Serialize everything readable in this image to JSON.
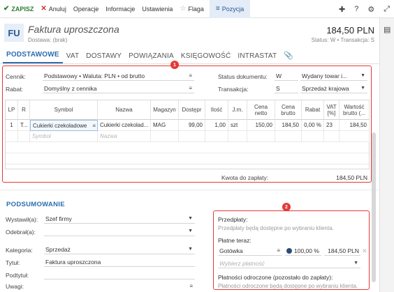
{
  "toolbar": {
    "save": "ZAPISZ",
    "cancel": "Anuluj",
    "operations": "Operacje",
    "info": "Informacje",
    "settings": "Ustawienia",
    "flag": "Flaga",
    "position": "Pozycja"
  },
  "header": {
    "badge": "FU",
    "title": "Faktura uproszczona",
    "subtitle": "Dostawa: (brak)",
    "amount": "184,50 PLN",
    "status_line": "Status: W • Transakcja: S"
  },
  "tabs": [
    "PODSTAWOWE",
    "VAT",
    "DOSTAWY",
    "POWIĄZANIA",
    "KSIĘGOWOŚĆ",
    "INTRASTAT"
  ],
  "markers": {
    "one": "1",
    "two": "2"
  },
  "form": {
    "cennik_label": "Cennik:",
    "cennik_value": "Podstawowy • Waluta: PLN • od brutto",
    "rabat_label": "Rabat:",
    "rabat_value": "Domyślny z cennika",
    "status_label": "Status dokumentu:",
    "status_code": "W",
    "status_value": "Wydany towar i...",
    "trans_label": "Transakcja:",
    "trans_code": "S",
    "trans_value": "Sprzedaż krajowa"
  },
  "grid": {
    "headers": [
      "LP",
      "R",
      "Symbol",
      "Nazwa",
      "Magazyn",
      "Dostępr",
      "Ilość",
      "J.m.",
      "Cena netto",
      "Cena brutto",
      "Rabat",
      "VAT [%]",
      "Wartość brutto (..."
    ],
    "row": {
      "lp": "1",
      "r": "T...",
      "symbol": "Cukierki czekoladowe",
      "nazwa": "Cukierki czekolad...",
      "magazyn": "MAG",
      "dostepne": "99,00",
      "ilosc": "1,00",
      "jm": "szt",
      "cena_netto": "150,00",
      "cena_brutto": "184,50",
      "rabat": "0,00 %",
      "vat": "23",
      "wartosc": "184,50"
    },
    "placeholder_symbol": "Symbol",
    "placeholder_nazwa": "Nazwa",
    "total_label": "Kwota do zapłaty:",
    "total_value": "184,50 PLN"
  },
  "summary": {
    "title": "PODSUMOWANIE",
    "wystawil_label": "Wystawił(a):",
    "wystawil_value": "Szef firmy",
    "odebral_label": "Odebrał(a):",
    "odebral_value": "",
    "kategoria_label": "Kategoria:",
    "kategoria_value": "Sprzedaż",
    "tytul_label": "Tytuł:",
    "tytul_value": "Faktura uproszczona",
    "podtytul_label": "Podtytuł:",
    "podtytul_value": "",
    "uwagi_label": "Uwagi:"
  },
  "payments": {
    "prepay_label": "Przedpłaty:",
    "prepay_note": "Przedpłaty będą dostępne po wybraniu klienta.",
    "paynow_label": "Płatne teraz:",
    "method": "Gotówka",
    "percent": "100,00 %",
    "amount": "184,50 PLN",
    "choose_placeholder": "Wybierz płatność",
    "deferred_label": "Płatności odroczone (pozostało do zapłaty):",
    "deferred_note": "Płatności odroczone będą dostępne po wybraniu klienta."
  }
}
